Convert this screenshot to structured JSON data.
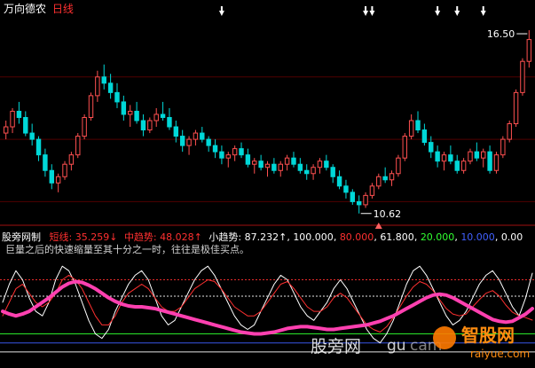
{
  "chart_data": [
    {
      "type": "candlestick",
      "title": "万向德农",
      "subtitle": "日线",
      "price_high_label": "16.50",
      "price_low_label": "10.62",
      "ylim": [
        10.3,
        16.9
      ],
      "up_color": "#ff5050",
      "down_color": "#00d8d8",
      "candles": [
        [
          13.2,
          13.6,
          13.0,
          13.4
        ],
        [
          13.4,
          14.0,
          13.2,
          13.9
        ],
        [
          13.9,
          14.2,
          13.5,
          13.7
        ],
        [
          13.7,
          13.9,
          13.1,
          13.2
        ],
        [
          13.2,
          13.5,
          12.8,
          13.0
        ],
        [
          13.0,
          13.1,
          12.3,
          12.5
        ],
        [
          12.5,
          12.7,
          11.8,
          12.0
        ],
        [
          12.0,
          12.2,
          11.4,
          11.6
        ],
        [
          11.6,
          11.9,
          11.3,
          11.8
        ],
        [
          11.8,
          12.3,
          11.7,
          12.2
        ],
        [
          12.2,
          12.6,
          12.0,
          12.5
        ],
        [
          12.5,
          13.2,
          12.4,
          13.1
        ],
        [
          13.1,
          13.8,
          13.0,
          13.7
        ],
        [
          13.7,
          14.5,
          13.6,
          14.4
        ],
        [
          14.4,
          15.2,
          14.2,
          15.0
        ],
        [
          15.0,
          15.4,
          14.6,
          14.8
        ],
        [
          14.8,
          15.1,
          14.3,
          14.5
        ],
        [
          14.5,
          14.8,
          14.0,
          14.2
        ],
        [
          14.2,
          14.4,
          13.6,
          13.8
        ],
        [
          13.8,
          14.1,
          13.4,
          13.9
        ],
        [
          13.9,
          14.2,
          13.5,
          13.6
        ],
        [
          13.6,
          13.8,
          13.1,
          13.3
        ],
        [
          13.3,
          13.7,
          13.2,
          13.6
        ],
        [
          13.6,
          14.0,
          13.4,
          13.8
        ],
        [
          13.8,
          14.2,
          13.6,
          13.7
        ],
        [
          13.7,
          14.0,
          13.3,
          13.4
        ],
        [
          13.4,
          13.6,
          12.9,
          13.1
        ],
        [
          13.1,
          13.3,
          12.6,
          12.8
        ],
        [
          12.8,
          13.1,
          12.5,
          13.0
        ],
        [
          13.0,
          13.3,
          12.8,
          13.2
        ],
        [
          13.2,
          13.4,
          12.9,
          13.0
        ],
        [
          13.0,
          13.1,
          12.6,
          12.8
        ],
        [
          12.8,
          13.0,
          12.4,
          12.6
        ],
        [
          12.6,
          12.8,
          12.2,
          12.4
        ],
        [
          12.4,
          12.6,
          12.1,
          12.5
        ],
        [
          12.5,
          12.8,
          12.3,
          12.7
        ],
        [
          12.7,
          12.9,
          12.4,
          12.5
        ],
        [
          12.5,
          12.7,
          12.1,
          12.2
        ],
        [
          12.2,
          12.4,
          11.9,
          12.3
        ],
        [
          12.3,
          12.5,
          12.0,
          12.1
        ],
        [
          12.1,
          12.3,
          11.8,
          12.2
        ],
        [
          12.2,
          12.4,
          11.9,
          12.0
        ],
        [
          12.0,
          12.3,
          11.8,
          12.2
        ],
        [
          12.2,
          12.5,
          12.0,
          12.4
        ],
        [
          12.4,
          12.6,
          12.1,
          12.2
        ],
        [
          12.2,
          12.4,
          11.9,
          12.0
        ],
        [
          12.0,
          12.2,
          11.7,
          11.9
        ],
        [
          11.9,
          12.2,
          11.7,
          12.1
        ],
        [
          12.1,
          12.4,
          11.9,
          12.3
        ],
        [
          12.3,
          12.5,
          12.0,
          12.1
        ],
        [
          12.1,
          12.2,
          11.6,
          11.8
        ],
        [
          11.8,
          12.0,
          11.4,
          11.5
        ],
        [
          11.5,
          11.7,
          11.1,
          11.3
        ],
        [
          11.3,
          11.4,
          10.9,
          11.0
        ],
        [
          11.0,
          11.2,
          10.62,
          10.9
        ],
        [
          10.9,
          11.3,
          10.8,
          11.2
        ],
        [
          11.2,
          11.6,
          11.1,
          11.5
        ],
        [
          11.5,
          11.9,
          11.4,
          11.8
        ],
        [
          11.8,
          12.1,
          11.6,
          11.7
        ],
        [
          11.7,
          12.0,
          11.5,
          11.9
        ],
        [
          11.9,
          12.5,
          11.8,
          12.4
        ],
        [
          12.4,
          13.2,
          12.3,
          13.1
        ],
        [
          13.1,
          13.8,
          13.0,
          13.6
        ],
        [
          13.6,
          13.9,
          13.2,
          13.3
        ],
        [
          13.3,
          13.5,
          12.8,
          12.9
        ],
        [
          12.9,
          13.1,
          12.4,
          12.6
        ],
        [
          12.6,
          12.8,
          12.1,
          12.3
        ],
        [
          12.3,
          12.6,
          12.0,
          12.5
        ],
        [
          12.5,
          12.8,
          12.2,
          12.3
        ],
        [
          12.3,
          12.5,
          11.9,
          12.0
        ],
        [
          12.0,
          12.4,
          11.9,
          12.3
        ],
        [
          12.3,
          12.7,
          12.2,
          12.6
        ],
        [
          12.6,
          12.9,
          12.3,
          12.4
        ],
        [
          12.4,
          12.7,
          12.1,
          12.6
        ],
        [
          12.6,
          12.8,
          11.9,
          12.0
        ],
        [
          12.0,
          12.6,
          11.9,
          12.5
        ],
        [
          12.5,
          13.1,
          12.4,
          13.0
        ],
        [
          13.0,
          13.6,
          12.9,
          13.5
        ],
        [
          13.5,
          14.6,
          13.4,
          14.5
        ],
        [
          14.5,
          15.6,
          14.4,
          15.5
        ],
        [
          15.5,
          16.5,
          15.3,
          16.2
        ]
      ],
      "markers": [
        {
          "candle": 33,
          "symbol": "arrow-down"
        },
        {
          "candle": 55,
          "symbol": "arrow-down"
        },
        {
          "candle": 56,
          "symbol": "arrow-down"
        },
        {
          "candle": 66,
          "symbol": "arrow-down"
        },
        {
          "candle": 69,
          "symbol": "arrow-down"
        },
        {
          "candle": 73,
          "symbol": "arrow-down"
        },
        {
          "candle": 57,
          "symbol": "triangle-up"
        }
      ]
    },
    {
      "type": "line",
      "title": "股旁网制",
      "annotation": "巨量之后的快速缩量至其十分之一时，往往是极佳买点。",
      "legend": [
        {
          "label": "短线:",
          "value": "35.259",
          "arrow": "↓",
          "color": "#ff3030"
        },
        {
          "label": "中趋势:",
          "value": "48.028",
          "arrow": "↑",
          "color": "#ff3030"
        },
        {
          "label": "小趋势:",
          "value": "87.232",
          "arrow": "↑",
          "color": "#ffffff"
        }
      ],
      "levels": [
        {
          "label": "100.000",
          "value": 100,
          "color": "#ffffff"
        },
        {
          "label": "80.000",
          "value": 80,
          "color": "#ff3030"
        },
        {
          "label": "61.800",
          "value": 61.8,
          "color": "#ffffff"
        },
        {
          "label": "20.000",
          "value": 20,
          "color": "#30ff30"
        },
        {
          "label": "10.000",
          "value": 10,
          "color": "#4060ff"
        },
        {
          "label": "0.00",
          "value": 0,
          "color": "#ffffff"
        }
      ],
      "ylim": [
        -5,
        105
      ],
      "series": [
        {
          "name": "小趋势",
          "color": "#ffffff",
          "width": 1,
          "values": [
            55,
            75,
            90,
            80,
            60,
            45,
            40,
            55,
            80,
            95,
            90,
            75,
            55,
            35,
            20,
            15,
            25,
            45,
            60,
            75,
            85,
            90,
            80,
            60,
            40,
            30,
            35,
            50,
            65,
            80,
            90,
            95,
            85,
            70,
            55,
            40,
            30,
            25,
            30,
            45,
            60,
            75,
            85,
            80,
            65,
            50,
            40,
            35,
            45,
            55,
            70,
            80,
            70,
            55,
            40,
            25,
            15,
            10,
            20,
            35,
            55,
            75,
            90,
            95,
            85,
            70,
            55,
            40,
            30,
            35,
            45,
            60,
            75,
            85,
            90,
            80,
            65,
            50,
            40,
            60,
            87.2
          ]
        },
        {
          "name": "短线",
          "color": "#ff3030",
          "width": 1,
          "values": [
            40,
            55,
            70,
            75,
            65,
            55,
            50,
            55,
            65,
            80,
            85,
            80,
            70,
            55,
            40,
            30,
            30,
            40,
            55,
            65,
            70,
            75,
            70,
            60,
            50,
            45,
            45,
            50,
            60,
            70,
            75,
            80,
            78,
            70,
            60,
            50,
            45,
            40,
            40,
            45,
            55,
            65,
            75,
            78,
            70,
            60,
            50,
            45,
            45,
            50,
            60,
            65,
            60,
            50,
            40,
            30,
            25,
            22,
            28,
            38,
            50,
            62,
            72,
            78,
            75,
            68,
            58,
            48,
            42,
            40,
            42,
            50,
            58,
            65,
            68,
            62,
            52,
            44,
            40,
            38,
            35.3
          ]
        },
        {
          "name": "中趋势",
          "color": "#ff40b0",
          "width": 4,
          "values": [
            45,
            42,
            40,
            42,
            45,
            50,
            55,
            60,
            66,
            72,
            76,
            78,
            77,
            74,
            70,
            65,
            60,
            56,
            53,
            51,
            50,
            50,
            49,
            48,
            46,
            44,
            42,
            40,
            38,
            36,
            34,
            32,
            30,
            28,
            26,
            24,
            22,
            21,
            20,
            20,
            21,
            22,
            24,
            26,
            27,
            28,
            28,
            27,
            26,
            25,
            25,
            26,
            27,
            28,
            29,
            30,
            32,
            34,
            37,
            40,
            44,
            48,
            52,
            56,
            60,
            63,
            64,
            63,
            60,
            56,
            52,
            48,
            44,
            40,
            36,
            34,
            33,
            34,
            38,
            42,
            48.0
          ]
        }
      ]
    }
  ],
  "watermark": {
    "site": "股旁网",
    "url_fragment": "gu",
    "url_tail": "cam",
    "brand": "智股网",
    "brand_url": "raiyue.com"
  }
}
